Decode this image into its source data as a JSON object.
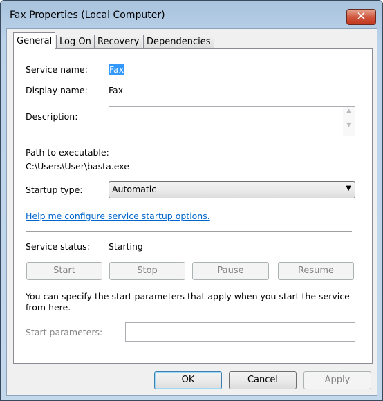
{
  "window": {
    "title": "Fax Properties (Local Computer)",
    "close_label": "✕"
  },
  "tabs": [
    {
      "label": "General",
      "active": true
    },
    {
      "label": "Log On"
    },
    {
      "label": "Recovery"
    },
    {
      "label": "Dependencies"
    }
  ],
  "general": {
    "service_name_label": "Service name:",
    "service_name": "Fax",
    "display_name_label": "Display name:",
    "display_name": "Fax",
    "description_label": "Description:",
    "description": "",
    "path_label": "Path to executable:",
    "path": "C:\\Users\\User\\basta.exe",
    "startup_type_label": "Startup type:",
    "startup_type": "Automatic",
    "help_link": "Help me configure service startup options.",
    "status_label": "Service status:",
    "status": "Starting",
    "buttons": {
      "start": "Start",
      "stop": "Stop",
      "pause": "Pause",
      "resume": "Resume"
    },
    "params_info": "You can specify the start parameters that apply when you start the service from here.",
    "params_label": "Start parameters:",
    "params_value": ""
  },
  "footer": {
    "ok": "OK",
    "cancel": "Cancel",
    "apply": "Apply"
  }
}
